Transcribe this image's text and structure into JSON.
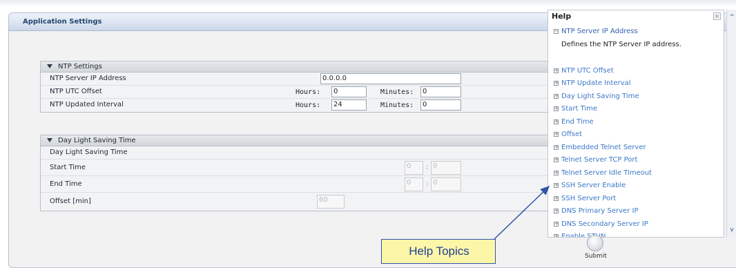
{
  "panel": {
    "title": "Application Settings"
  },
  "ntp": {
    "title": "NTP Settings",
    "rows": [
      {
        "label": "NTP Server IP Address",
        "value": "0.0.0.0"
      },
      {
        "label": "NTP UTC Offset",
        "hours_label": "Hours:",
        "hours": "0",
        "minutes_label": "Minutes:",
        "minutes": "0"
      },
      {
        "label": "NTP Updated Interval",
        "hours_label": "Hours:",
        "hours": "24",
        "minutes_label": "Minutes:",
        "minutes": "0"
      }
    ]
  },
  "dst": {
    "title": "Day Light Saving Time",
    "rows": [
      {
        "label": "Day Light Saving Time"
      },
      {
        "label": "Start Time",
        "v1": "0",
        "v2": "0",
        "sep": ":"
      },
      {
        "label": "End Time",
        "v1": "0",
        "v2": "0",
        "sep": ":"
      },
      {
        "label": "Offset [min]",
        "value": "60"
      }
    ]
  },
  "help": {
    "title": "Help",
    "close": "×",
    "expanded_item": "NTP Server IP Address",
    "expanded_desc": "Defines the NTP Server IP address.",
    "items": [
      "NTP UTC Offset",
      "NTP Update Interval",
      "Day Light Saving Time",
      "Start Time",
      "End Time",
      "Offset",
      "Embedded Telnet Server",
      "Telnet Server TCP Port",
      "Telnet Server Idle Timeout",
      "SSH Server Enable",
      "SSH Server Port",
      "DNS Primary Server IP",
      "DNS Secondary Server IP",
      "Enable STUN"
    ]
  },
  "submit": {
    "label": "Submit"
  },
  "callout": {
    "text": "Help Topics"
  },
  "colors": {
    "accent": "#25456f",
    "link": "#3a78c8",
    "callout_bg": "#fbf6a8",
    "arrow": "#2e53a7"
  }
}
